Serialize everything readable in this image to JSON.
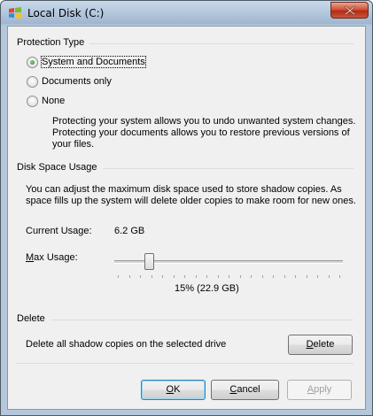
{
  "window": {
    "title": "Local Disk (C:)",
    "close_label": "Close"
  },
  "protection": {
    "heading": "Protection Type",
    "options": [
      {
        "label": "System and Documents",
        "checked": true
      },
      {
        "label": "Documents only",
        "checked": false
      },
      {
        "label": "None",
        "checked": false
      }
    ],
    "description_lines": [
      "Protecting your system allows you to undo unwanted system changes.",
      "Protecting your documents allows you to restore previous versions of",
      "your files."
    ]
  },
  "disk_space": {
    "heading": "Disk Space Usage",
    "description_lines": [
      "You can adjust the maximum disk space used to store shadow copies. As",
      "space fills up the system will delete older copies to make room for new ones."
    ],
    "current_label": "Current Usage:",
    "current_value": "6.2 GB",
    "max_label": "Max Usage:",
    "max_value_text": "15% (22.9 GB)",
    "max_percent": 15
  },
  "delete": {
    "heading": "Delete",
    "description": "Delete all shadow copies on the selected drive",
    "button_label": "Delete"
  },
  "buttons": {
    "ok": "OK",
    "cancel": "Cancel",
    "apply": "Apply"
  },
  "colors": {
    "title_bar": "#9fb6cf",
    "close_button": "#c6452b",
    "default_button_border": "#3c7fb1",
    "disabled_text": "#a0a0a0"
  }
}
